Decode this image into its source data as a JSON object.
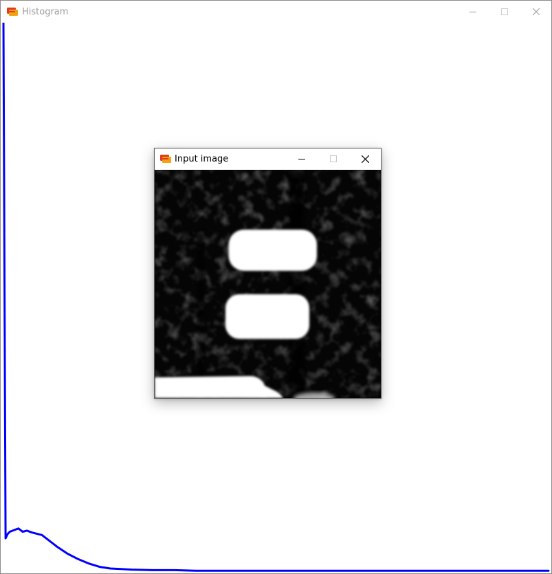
{
  "histogram_window": {
    "title": "Histogram",
    "icon": "app-icon",
    "controls": [
      "minimize-icon",
      "maximize-icon",
      "close-icon"
    ],
    "plot": {
      "line_color": "#0000ff",
      "bins": 256,
      "max_bin": 0,
      "background": "#ffffff"
    }
  },
  "input_window": {
    "title": "Input image",
    "icon": "app-icon",
    "controls": [
      "minimize-icon",
      "maximize-icon",
      "close-icon"
    ],
    "image": {
      "description_icon": "grayscale-blob-image",
      "foreground": "#ffffff",
      "background": "#000000"
    }
  },
  "colors": {
    "title_inactive": "#9a9a9a",
    "title_active": "#000000",
    "icon_red": "#e23a1e",
    "icon_orange": "#f2a20e"
  },
  "chart_data": {
    "type": "line",
    "x": [
      0,
      1,
      2,
      3,
      5,
      7,
      9,
      11,
      13,
      15,
      18,
      20,
      25,
      30,
      35,
      40,
      45,
      50,
      55,
      60,
      70,
      80,
      90,
      100,
      110,
      120,
      130,
      140,
      150,
      160,
      170,
      180,
      190,
      200,
      210,
      220,
      230,
      240,
      250,
      255
    ],
    "series": [
      {
        "values": [
          1.0,
          0.06,
          0.068,
          0.072,
          0.075,
          0.078,
          0.072,
          0.074,
          0.071,
          0.069,
          0.066,
          0.06,
          0.045,
          0.032,
          0.022,
          0.014,
          0.008,
          0.005,
          0.004,
          0.003,
          0.002,
          0.002,
          0.001,
          0.001,
          0.001,
          0.001,
          0.001,
          0.001,
          0.001,
          0.001,
          0.001,
          0.001,
          0.001,
          0.001,
          0.001,
          0.001,
          0.001,
          0.001,
          0.001,
          0.001
        ]
      }
    ],
    "ylim": [
      0,
      1
    ],
    "xlim": [
      0,
      255
    ],
    "grid": false
  }
}
